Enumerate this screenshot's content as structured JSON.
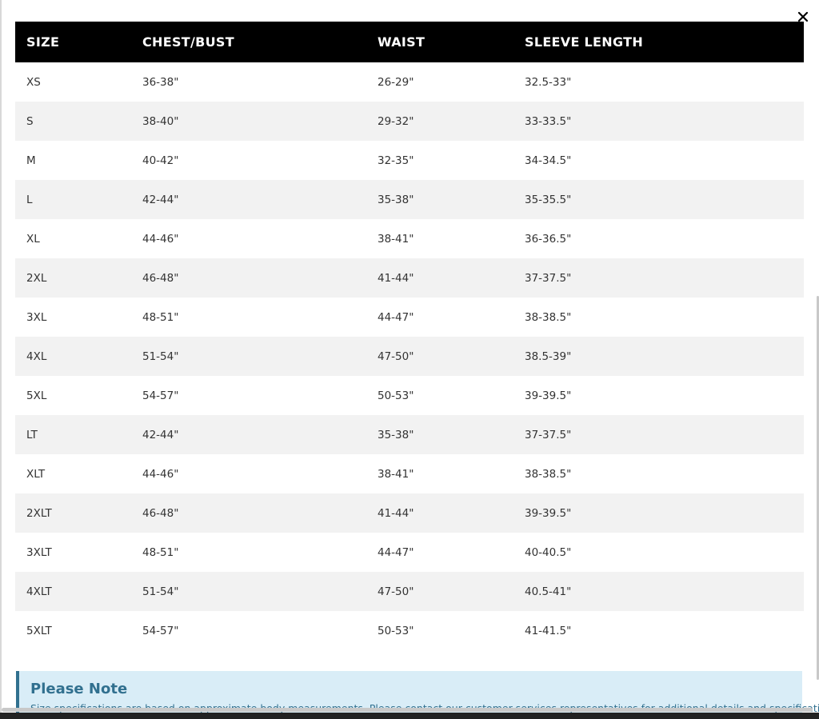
{
  "close": {
    "icon": "close-icon",
    "label": "×"
  },
  "table": {
    "headers": [
      "SIZE",
      "CHEST/BUST",
      "WAIST",
      "SLEEVE LENGTH"
    ],
    "rows": [
      [
        "XS",
        "36-38\"",
        "26-29\"",
        "32.5-33\""
      ],
      [
        "S",
        "38-40\"",
        "29-32\"",
        "33-33.5\""
      ],
      [
        "M",
        "40-42\"",
        "32-35\"",
        "34-34.5\""
      ],
      [
        "L",
        "42-44\"",
        "35-38\"",
        "35-35.5\""
      ],
      [
        "XL",
        "44-46\"",
        "38-41\"",
        "36-36.5\""
      ],
      [
        "2XL",
        "46-48\"",
        "41-44\"",
        "37-37.5\""
      ],
      [
        "3XL",
        "48-51\"",
        "44-47\"",
        "38-38.5\""
      ],
      [
        "4XL",
        "51-54\"",
        "47-50\"",
        "38.5-39\""
      ],
      [
        "5XL",
        "54-57\"",
        "50-53\"",
        "39-39.5\""
      ],
      [
        "LT",
        "42-44\"",
        "35-38\"",
        "37-37.5\""
      ],
      [
        "XLT",
        "44-46\"",
        "38-41\"",
        "38-38.5\""
      ],
      [
        "2XLT",
        "46-48\"",
        "41-44\"",
        "39-39.5\""
      ],
      [
        "3XLT",
        "48-51\"",
        "44-47\"",
        "40-40.5\""
      ],
      [
        "4XLT",
        "51-54\"",
        "47-50\"",
        "40.5-41\""
      ],
      [
        "5XLT",
        "54-57\"",
        "50-53\"",
        "41-41.5\""
      ]
    ]
  },
  "note": {
    "title": "Please Note",
    "text": "Size specifications are based on approximate body measurements. Please contact our customer services representatives for additional details and specifications."
  },
  "colors": {
    "header_bg": "#000000",
    "row_alt_bg": "#f2f2f2",
    "note_bg": "#d9edf7",
    "note_text": "#31708f"
  }
}
